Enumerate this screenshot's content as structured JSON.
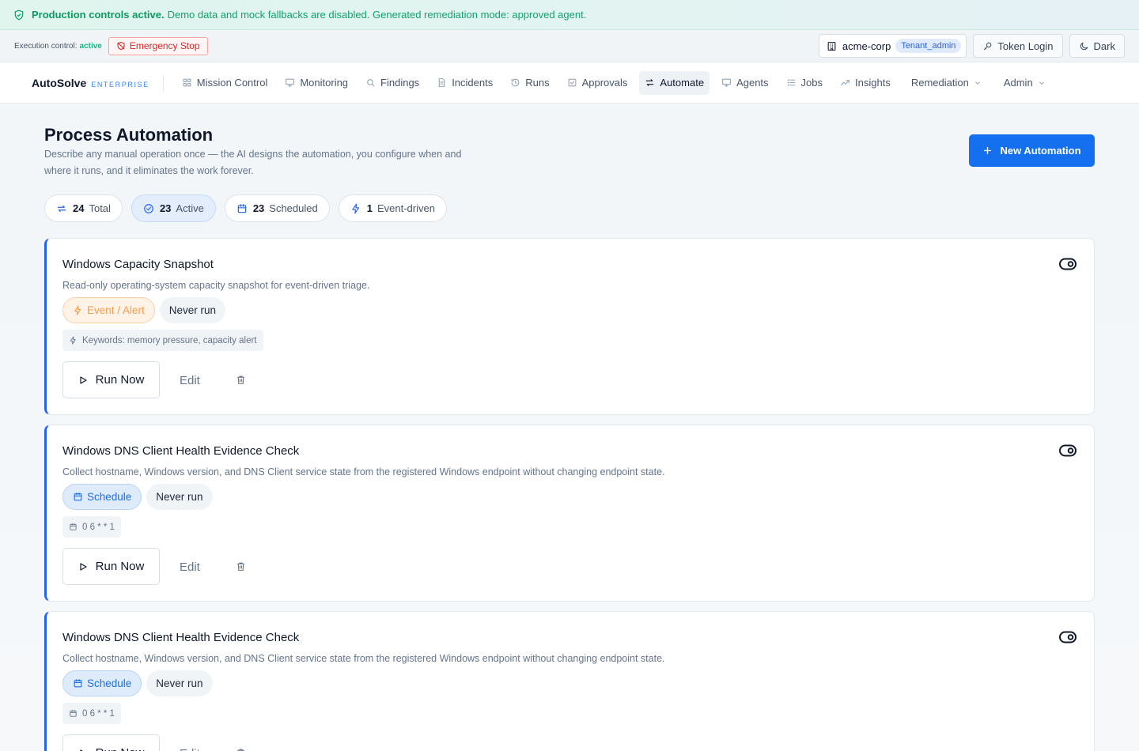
{
  "banner": {
    "strong": "Production controls active.",
    "text": "Demo data and mock fallbacks are disabled. Generated remediation mode: approved agent."
  },
  "control_bar": {
    "exec_label": "Execution control:",
    "exec_state": "active",
    "estop_label": "Emergency Stop",
    "tenant": "acme-corp",
    "role": "Tenant_admin",
    "token_login": "Token Login",
    "theme": "Dark"
  },
  "nav": {
    "brand": "AutoSolve",
    "brand_tag": "ENTERPRISE",
    "items": [
      {
        "label": "Mission Control",
        "icon": "grid-icon"
      },
      {
        "label": "Monitoring",
        "icon": "monitor-icon"
      },
      {
        "label": "Findings",
        "icon": "search-icon"
      },
      {
        "label": "Incidents",
        "icon": "document-icon"
      },
      {
        "label": "Runs",
        "icon": "history-icon"
      },
      {
        "label": "Approvals",
        "icon": "checkbox-icon"
      },
      {
        "label": "Automate",
        "icon": "swap-icon"
      },
      {
        "label": "Agents",
        "icon": "monitor-icon"
      },
      {
        "label": "Jobs",
        "icon": "list-icon"
      },
      {
        "label": "Insights",
        "icon": "trend-icon"
      }
    ],
    "active": "Automate",
    "remediation": "Remediation",
    "admin": "Admin"
  },
  "page": {
    "title": "Process Automation",
    "subtitle": "Describe any manual operation once — the AI designs the automation, you configure when and where it runs, and it eliminates the work forever.",
    "new_button": "New Automation"
  },
  "stats": [
    {
      "num": "24",
      "label": "Total",
      "icon": "repeat-icon"
    },
    {
      "num": "23",
      "label": "Active",
      "icon": "check-circle-icon"
    },
    {
      "num": "23",
      "label": "Scheduled",
      "icon": "calendar-icon"
    },
    {
      "num": "1",
      "label": "Event-driven",
      "icon": "bolt-icon"
    }
  ],
  "automations": [
    {
      "name": "Windows Capacity Snapshot",
      "description": "Read-only operating-system capacity snapshot for event-driven triage.",
      "trigger": "Event / Alert",
      "status": "Never run",
      "meta": "Keywords: memory pressure, capacity alert"
    },
    {
      "name": "Windows DNS Client Health Evidence Check",
      "description": "Collect hostname, Windows version, and DNS Client service state from the registered Windows endpoint without changing endpoint state.",
      "trigger": "Schedule",
      "status": "Never run",
      "meta": "0 6 * * 1"
    },
    {
      "name": "Windows DNS Client Health Evidence Check",
      "description": "Collect hostname, Windows version, and DNS Client service state from the registered Windows endpoint without changing endpoint state.",
      "trigger": "Schedule",
      "status": "Never run",
      "meta": "0 6 * * 1"
    }
  ],
  "card_actions": {
    "run": "Run Now",
    "edit": "Edit"
  },
  "colors": {
    "accent": "#1570ef",
    "success": "#10a26a",
    "danger": "#dc2626",
    "event": "#f59e4b"
  }
}
